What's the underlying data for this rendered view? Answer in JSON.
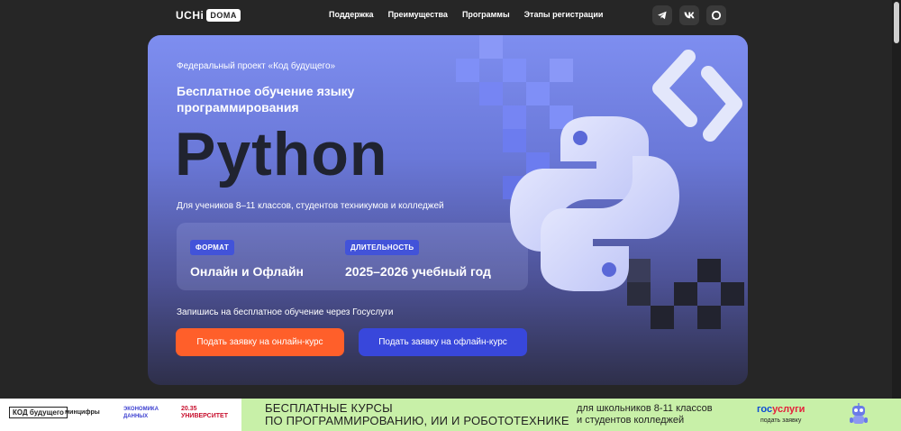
{
  "header": {
    "logo_uchi": "UCHi",
    "logo_doma": "DOMA",
    "nav": [
      "Поддержка",
      "Преимущества",
      "Программы",
      "Этапы регистрации"
    ],
    "socials": [
      "telegram-icon",
      "vk-icon",
      "max-icon"
    ]
  },
  "hero": {
    "eyebrow": "Федеральный проект «Код будущего»",
    "subtitle": "Бесплатное обучение языку программирования",
    "title": "Python",
    "audience": "Для учеников 8–11 классов, студентов техникумов и колледжей",
    "format_label": "ФОРМАТ",
    "format_value": "Онлайн и Офлайн",
    "duration_label": "ДЛИТЕЛЬНОСТЬ",
    "duration_value": "2025–2026 учебный год",
    "cta_text": "Запишись на бесплатное обучение через Госуслуги",
    "btn_online": "Подать заявку на онлайн-курс",
    "btn_offline": "Подать заявку на офлайн-курс"
  },
  "banner": {
    "partners": [
      "КОД будущего",
      "минцифры",
      "ЭКОНОМИКА ДАННЫХ",
      "20.35 УНИВЕРСИТЕТ"
    ],
    "title_line1": "БЕСПЛАТНЫЕ КУРСЫ",
    "title_line2": "ПО ПРОГРАММИРОВАНИЮ, ИИ И РОБОТОТЕХНИКЕ",
    "sub_line1": "для школьников 8-11 классов",
    "sub_line2": "и студентов колледжей",
    "gos_part1": "гос",
    "gos_part2": "услуги",
    "gos_sub": "подать заявку"
  },
  "colors": {
    "accent_orange": "#ff5f2a",
    "accent_blue": "#3847db",
    "banner_green": "#c8f0a8"
  }
}
